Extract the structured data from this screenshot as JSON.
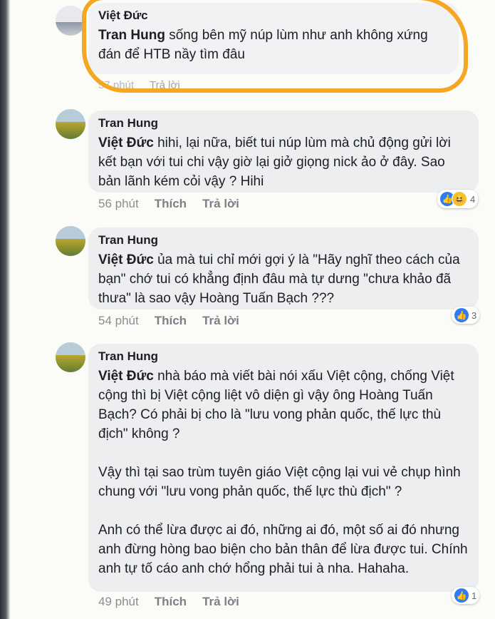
{
  "comments": [
    {
      "author": "Việt Đức",
      "tag": "Tran Hung",
      "text": " sống bên mỹ núp lùm như anh không xứng đán để HTB nầy tìm đâu",
      "time": "57 phút",
      "reply": "Trả lời"
    },
    {
      "author": "Tran Hung",
      "tag": "Việt Đức",
      "text": " hihi, lại nữa, biết tui núp lùm mà chủ động gửi lời kết bạn với tui chi vậy giờ lại giở giọng nick ảo ở đây. Sao bản lãnh kém cỏi vậy ? Hihi",
      "time": "56 phút",
      "like": "Thích",
      "reply": "Trả lời",
      "reactions": "4"
    },
    {
      "author": "Tran Hung",
      "tag": "Việt Đức",
      "text": " ủa mà tui chỉ mới gợi ý là \"Hãy nghĩ theo cách của bạn\" chớ tui có khẳng định đâu mà tự dưng \"chưa khảo đã thưa\" là sao vậy Hoàng Tuấn Bạch ???",
      "time": "54 phút",
      "like": "Thích",
      "reply": "Trả lời",
      "reactions": "3"
    },
    {
      "author": "Tran Hung",
      "tag": "Việt Đức",
      "text": " nhà báo mà viết bài nói xấu Việt cộng, chống Việt cộng thì bị Việt cộng liệt vô diện gì vậy ông Hoàng Tuấn Bạch? Có phải bị cho là \"lưu vong phản quốc, thế lực thù địch\" không ?",
      "para2": "Vậy thì tại sao trùm tuyên giáo Việt cộng lại vui vẻ chụp hình chung với \"lưu vong phản quốc, thế lực thù địch\" ?",
      "para3": "Anh có thể lừa được ai đó, những ai đó, một số ai đó nhưng anh đừng hòng bao biện cho bản thân để lừa được tui. Chính anh tự tố cáo anh chớ hổng phải tui à nha. Hahaha.",
      "time": "49 phút",
      "like": "Thích",
      "reply": "Trả lời",
      "reactions": "1"
    }
  ],
  "colors": {
    "highlight": "#f5a623",
    "like": "#2d7cf5",
    "bubble": "#eceef0"
  }
}
